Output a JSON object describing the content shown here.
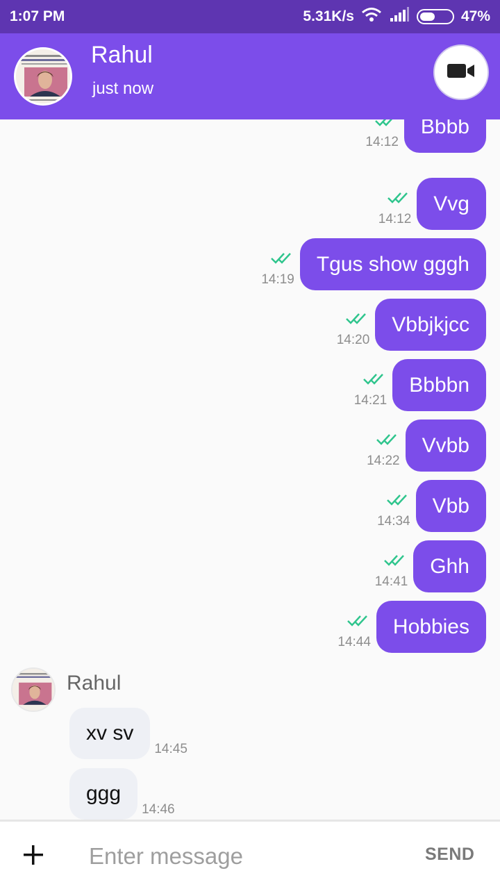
{
  "status_bar": {
    "time": "1:07 PM",
    "net_speed": "5.31K/s",
    "battery": "47%",
    "battery_level": 0.47,
    "icons": [
      "wifi-icon",
      "signal-icon",
      "battery-icon"
    ]
  },
  "header": {
    "title": "Rahul",
    "subtitle": "just now",
    "video_icon": "video-camera-icon"
  },
  "colors": {
    "status_bar": "#5e35b1",
    "header": "#7c4dea",
    "bubble_out": "#7c4dea",
    "bubble_in": "#eef0f5",
    "read_ticks": "#2fc58d"
  },
  "messages_out": [
    {
      "text": "Bbbb",
      "time": "14:12"
    },
    {
      "text": "Vvg",
      "time": "14:12"
    },
    {
      "text": "Tgus show gggh",
      "time": "14:19"
    },
    {
      "text": "Vbbjkjcc",
      "time": "14:20"
    },
    {
      "text": "Bbbbn",
      "time": "14:21"
    },
    {
      "text": "Vvbb",
      "time": "14:22"
    },
    {
      "text": "Vbb",
      "time": "14:34"
    },
    {
      "text": "Ghh",
      "time": "14:41"
    },
    {
      "text": "Hobbies",
      "time": "14:44"
    }
  ],
  "incoming": {
    "sender": "Rahul",
    "messages": [
      {
        "text": "xv sv",
        "time": "14:45"
      },
      {
        "text": "ggg",
        "time": "14:46"
      }
    ]
  },
  "composer": {
    "placeholder": "Enter message",
    "send_label": "SEND",
    "attach_icon": "plus-icon"
  }
}
